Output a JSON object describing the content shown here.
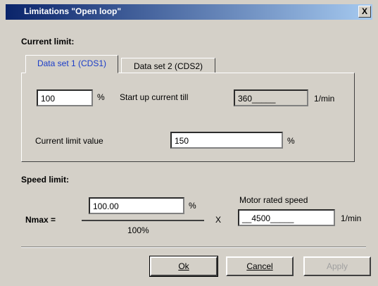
{
  "window": {
    "title": "Limitations \"Open loop\"",
    "close_glyph": "X"
  },
  "current_limit": {
    "heading": "Current limit:",
    "tabs": [
      {
        "label": "Data set 1 (CDS1)",
        "active": true
      },
      {
        "label": "Data set 2 (CDS2)",
        "active": false
      }
    ],
    "percent_value": "100",
    "percent_unit": "%",
    "startup_label": "Start up current till",
    "startup_value": "360_____",
    "startup_unit": "1/min",
    "limit_label": "Current limit value",
    "limit_value": "150",
    "limit_unit": "%"
  },
  "speed_limit": {
    "heading": "Speed limit:",
    "nmax_label": "Nmax =",
    "numerator_value": "100.00",
    "numerator_unit": "%",
    "denominator": "100%",
    "times": "X",
    "motor_label": "Motor rated speed",
    "motor_value": "__4500_____",
    "motor_unit": "1/min"
  },
  "buttons": {
    "ok": "Ok",
    "cancel": "Cancel",
    "apply": "Apply"
  },
  "colors": {
    "title_start": "#0a246a",
    "title_end": "#a6caf0",
    "active_tab_text": "#1a3cc8",
    "dialog_bg": "#d4d0c8"
  }
}
